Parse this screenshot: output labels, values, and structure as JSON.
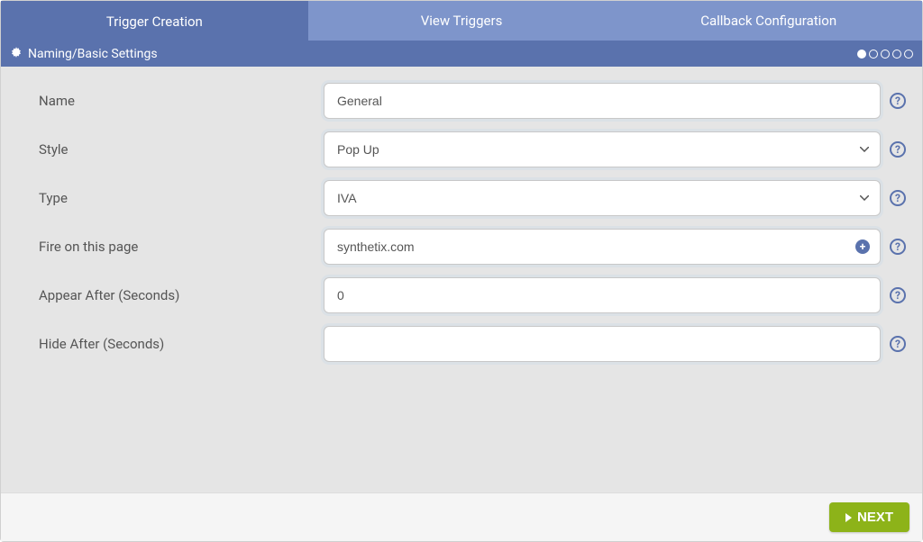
{
  "tabs": {
    "trigger_creation": "Trigger Creation",
    "view_triggers": "View Triggers",
    "callback_config": "Callback Configuration"
  },
  "section": {
    "title": "Naming/Basic Settings"
  },
  "form": {
    "name": {
      "label": "Name",
      "value": "General"
    },
    "style": {
      "label": "Style",
      "value": "Pop Up"
    },
    "type": {
      "label": "Type",
      "value": "IVA"
    },
    "fire_page": {
      "label": "Fire on this page",
      "value": "synthetix.com"
    },
    "appear_after": {
      "label": "Appear After (Seconds)",
      "value": "0"
    },
    "hide_after": {
      "label": "Hide After (Seconds)",
      "value": ""
    }
  },
  "footer": {
    "next": "NEXT"
  }
}
